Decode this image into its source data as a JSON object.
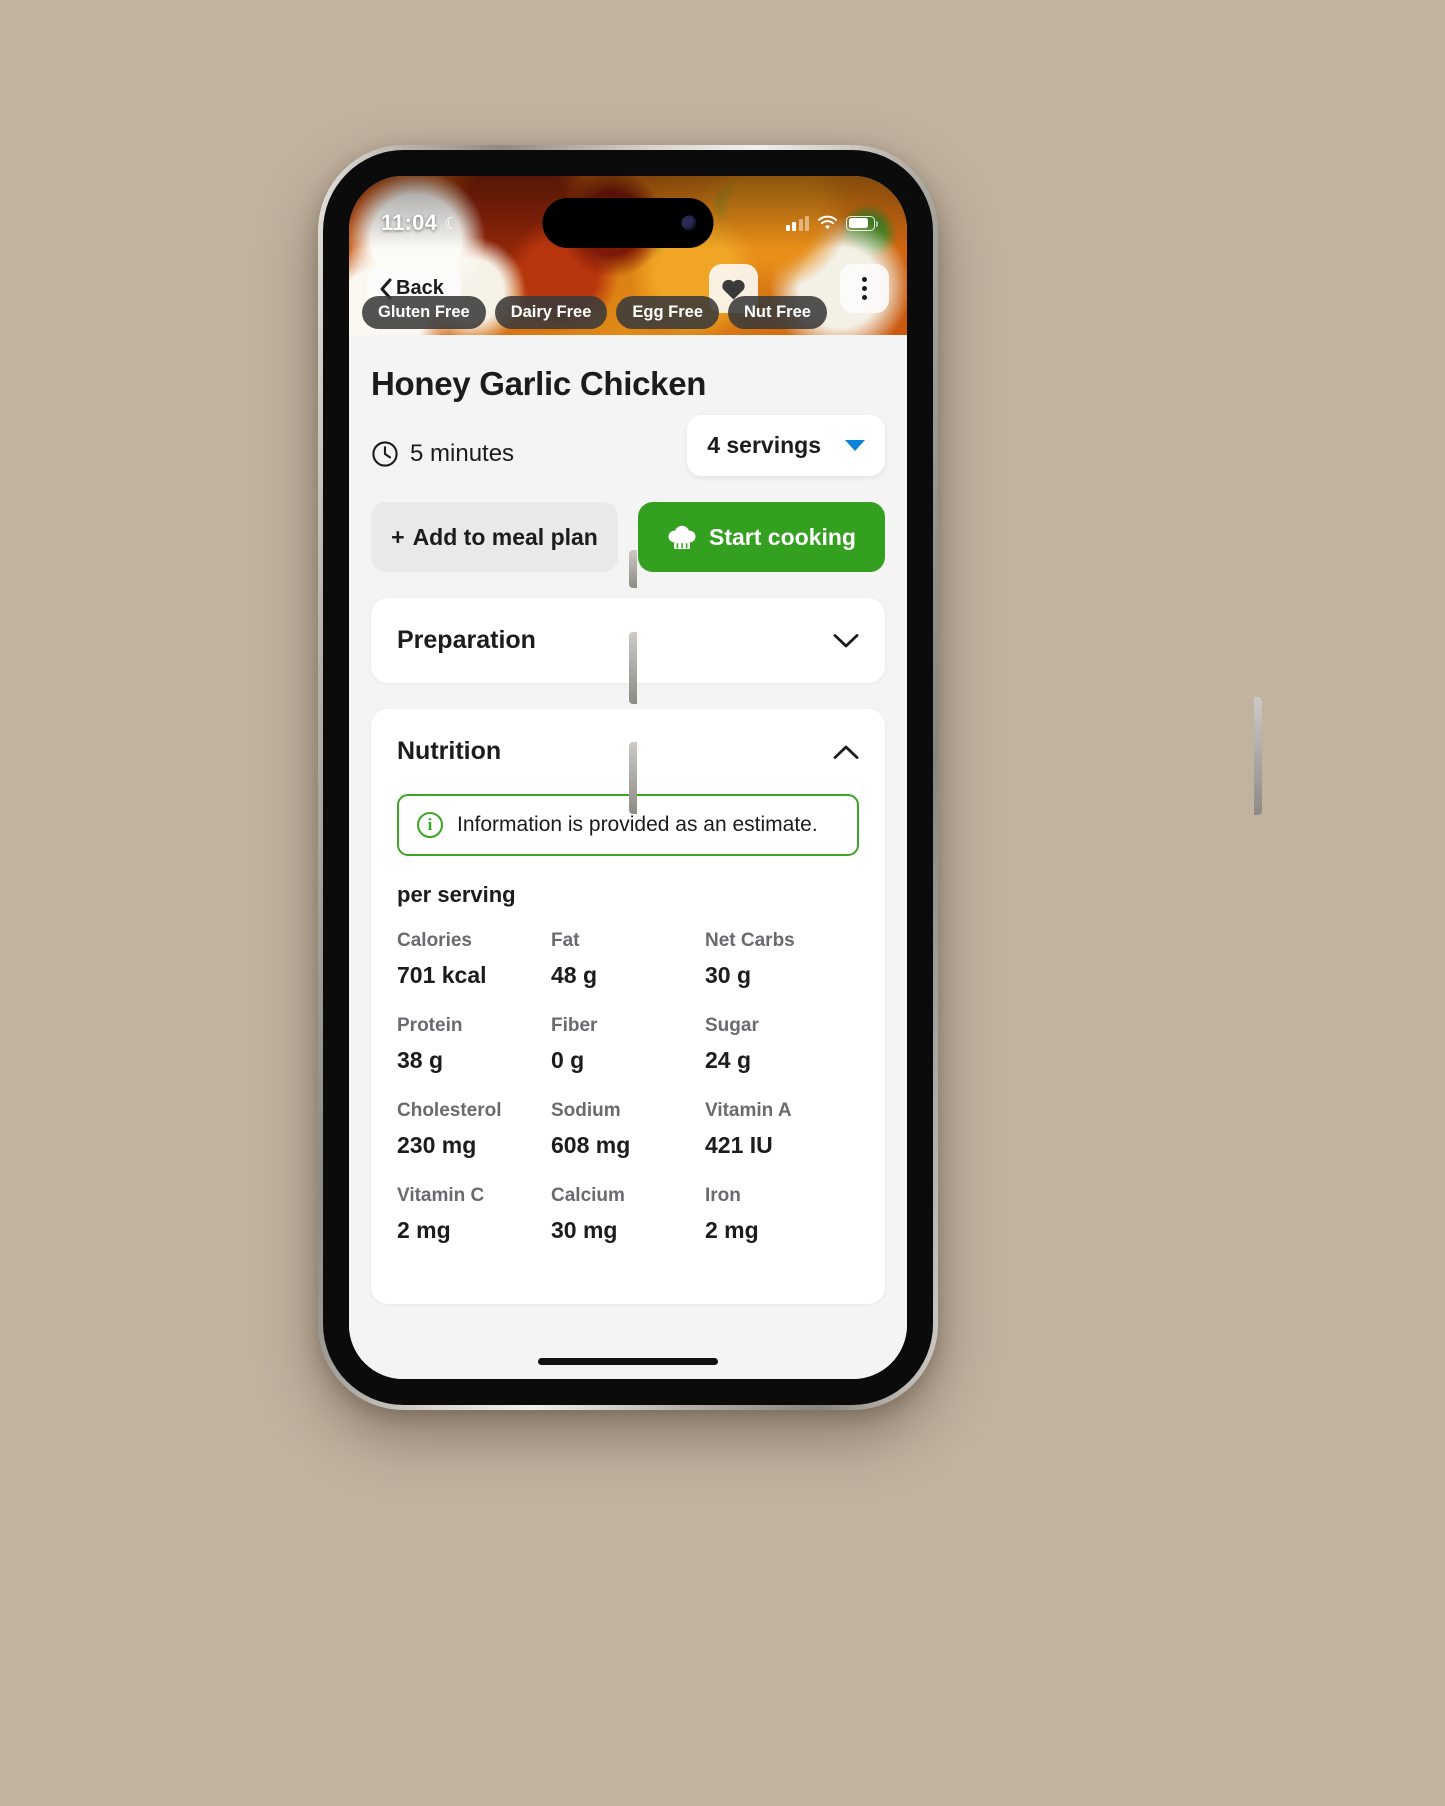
{
  "status_bar": {
    "time": "11:04",
    "moon_glyph": "☾",
    "signal_icon": "cellular-signal-icon",
    "wifi_icon": "wifi-icon",
    "battery_icon": "battery-icon"
  },
  "hero": {
    "back_label": "Back",
    "favorite_icon": "heart-icon",
    "more_icon": "more-options-icon",
    "badges": [
      "Gluten Free",
      "Dairy Free",
      "Egg Free",
      "Nut Free"
    ]
  },
  "recipe": {
    "title": "Honey Garlic Chicken",
    "time_icon": "clock-icon",
    "time_text": "5 minutes",
    "servings_value": "4 servings",
    "add_to_meal_plan": "Add to meal plan",
    "add_icon": "plus-icon",
    "start_cooking": "Start cooking",
    "chef_hat_icon": "chef-hat-icon"
  },
  "sections": {
    "preparation": {
      "title": "Preparation",
      "chevron": "chevron-down-icon",
      "expanded": false
    },
    "nutrition": {
      "title": "Nutrition",
      "chevron": "chevron-up-icon",
      "expanded": true,
      "estimate_notice": "Information is provided as an estimate.",
      "estimate_icon": "info-icon",
      "per_serving_label": "per serving",
      "items": [
        {
          "label": "Calories",
          "value": "701 kcal"
        },
        {
          "label": "Fat",
          "value": "48 g"
        },
        {
          "label": "Net Carbs",
          "value": "30 g"
        },
        {
          "label": "Protein",
          "value": "38 g"
        },
        {
          "label": "Fiber",
          "value": "0 g"
        },
        {
          "label": "Sugar",
          "value": "24 g"
        },
        {
          "label": "Cholesterol",
          "value": "230 mg"
        },
        {
          "label": "Sodium",
          "value": "608 mg"
        },
        {
          "label": "Vitamin A",
          "value": "421 IU"
        },
        {
          "label": "Vitamin C",
          "value": "2 mg"
        },
        {
          "label": "Calcium",
          "value": "30 mg"
        },
        {
          "label": "Iron",
          "value": "2 mg"
        }
      ]
    }
  },
  "colors": {
    "accent_green": "#34a01f",
    "estimate_border": "#3ca526",
    "dropdown_caret": "#0a84d8",
    "page_background": "#c2b3a1"
  }
}
